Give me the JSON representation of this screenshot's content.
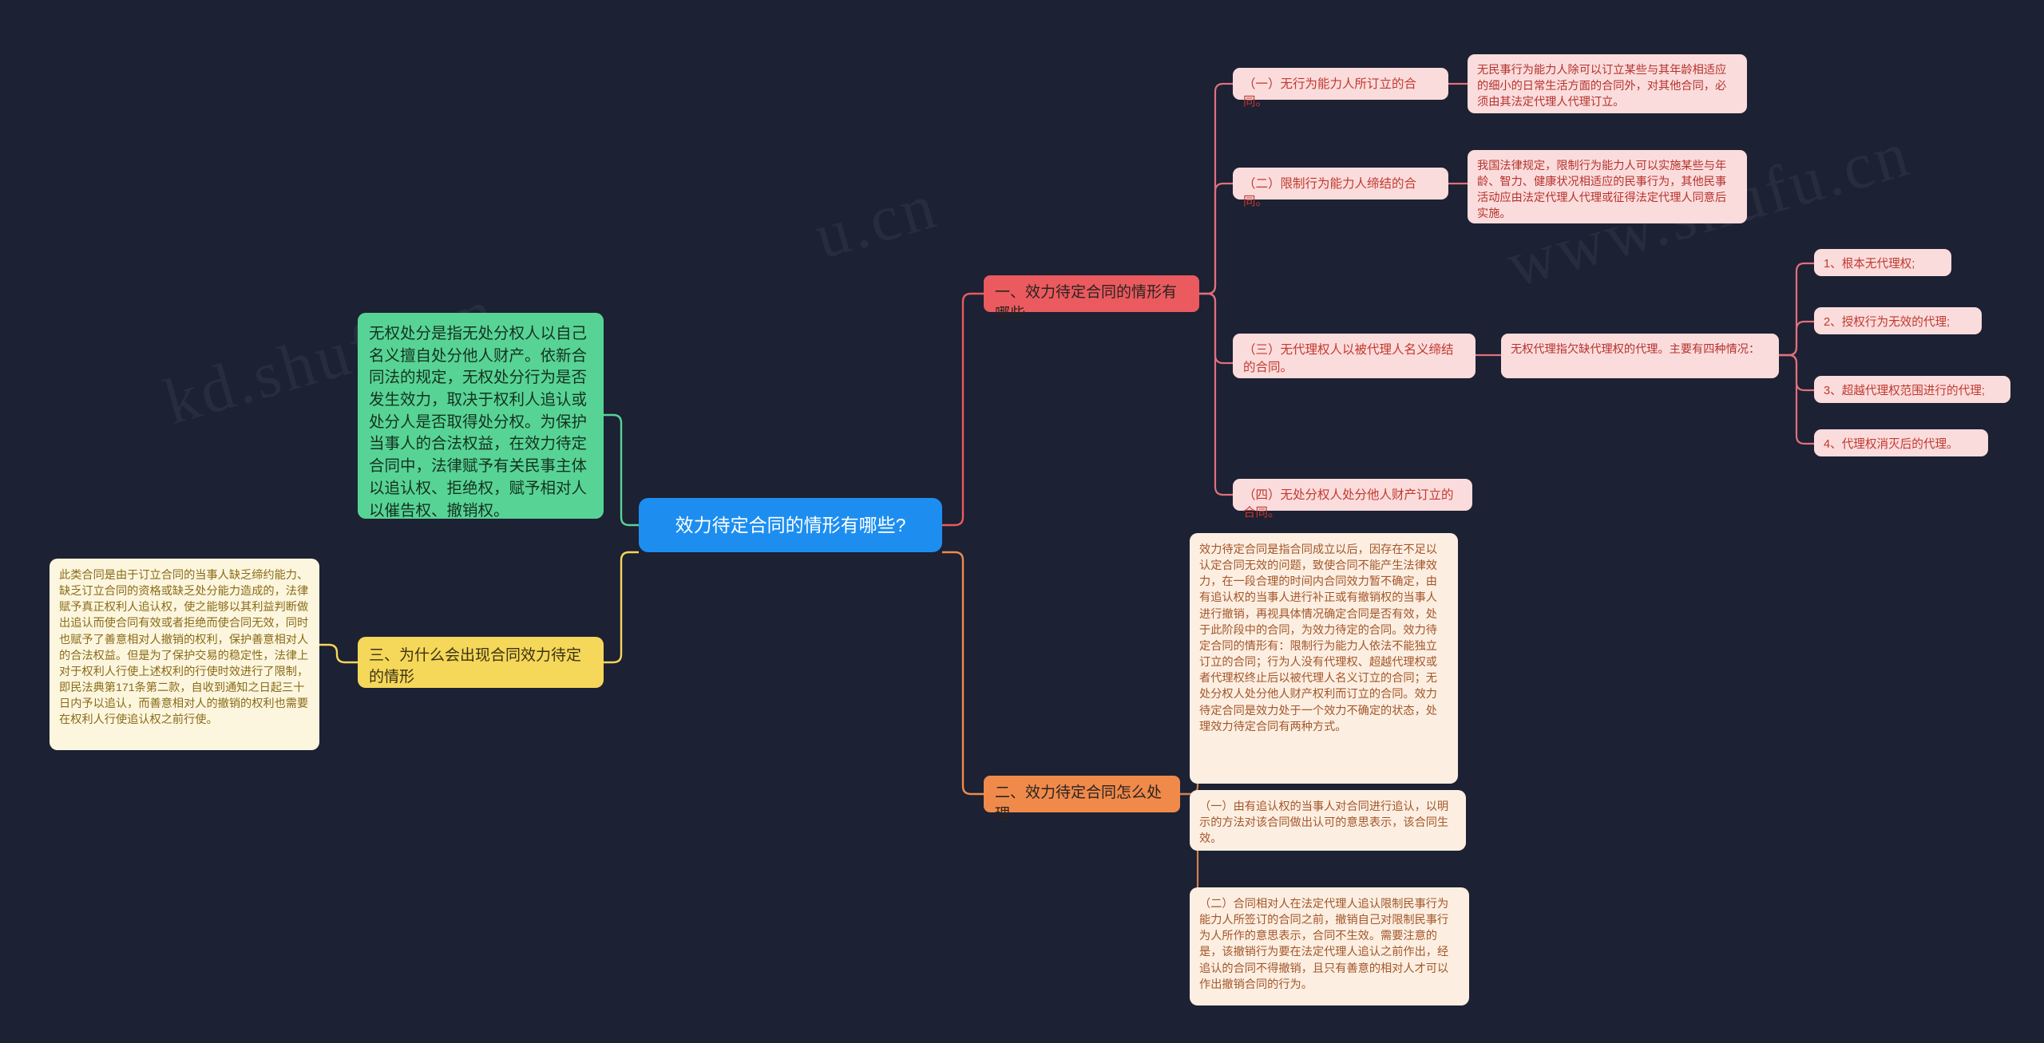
{
  "watermarks": [
    "kd.shufu.cn",
    "u.cn",
    "www.shufu.cn"
  ],
  "central": {
    "label": "效力待定合同的情形有哪些?",
    "color": "#1d8ef0"
  },
  "left_branch": {
    "green_note": "无权处分是指无处分权人以自己名义擅自处分他人财产。依新合同法的规定，无权处分行为是否发生效力，取决于权利人追认或处分人是否取得处分权。为保护当事人的合法权益，在效力待定合同中，法律赋予有关民事主体以追认权、拒绝权，赋予相对人以催告权、撤销权。",
    "green_color": "#58d396",
    "topic": "三、为什么会出现合同效力待定的情形",
    "topic_color": "#f5d759",
    "detail": "此类合同是由于订立合同的当事人缺乏缔约能力、缺乏订立合同的资格或缺乏处分能力造成的，法律赋予真正权利人追认权，使之能够以其利益判断做出追认而使合同有效或者拒绝而使合同无效，同时也赋予了善意相对人撤销的权利，保护善意相对人的合法权益。但是为了保护交易的稳定性，法律上对于权利人行使上述权利的行使时效进行了限制，即民法典第171条第二款，自收到通知之日起三十日内予以追认，而善意相对人的撤销的权利也需要在权利人行使追认权之前行使。",
    "detail_color": "#fdf6df"
  },
  "branch1": {
    "label": "一、效力待定合同的情形有哪些",
    "color": "#ea5a5e",
    "items": [
      {
        "label": "（一）无行为能力人所订立的合同。",
        "note": "无民事行为能力人除可以订立某些与其年龄相适应的细小的日常生活方面的合同外，对其他合同，必须由其法定代理人代理订立。"
      },
      {
        "label": "（二）限制行为能力人缔结的合同。",
        "note": "我国法律规定，限制行为能力人可以实施某些与年龄、智力、健康状况相适应的民事行为，其他民事活动应由法定代理人代理或征得法定代理人同意后实施。"
      },
      {
        "label": "（三）无代理权人以被代理人名义缔结的合同。",
        "note": "无权代理指欠缺代理权的代理。主要有四种情况：",
        "subitems": [
          "1、根本无代理权;",
          "2、授权行为无效的代理;",
          "3、超越代理权范围进行的代理;",
          "4、代理权消灭后的代理。"
        ]
      },
      {
        "label": "（四）无处分权人处分他人财产订立的合同。",
        "note": ""
      }
    ]
  },
  "branch2": {
    "label": "二、效力待定合同怎么处理",
    "color": "#f08a4b",
    "intro": "效力待定合同是指合同成立以后，因存在不足以认定合同无效的问题，致使合同不能产生法律效力，在一段合理的时间内合同效力暂不确定，由有追认权的当事人进行补正或有撤销权的当事人进行撤销，再视具体情况确定合同是否有效，处于此阶段中的合同，为效力待定的合同。效力待定合同的情形有：限制行为能力人依法不能独立订立的合同；行为人没有代理权、超越代理权或者代理权终止后以被代理人名义订立的合同；无处分权人处分他人财产权利而订立的合同。效力待定合同是效力处于一个效力不确定的状态，处理效力待定合同有两种方式。",
    "items": [
      "（一）由有追认权的当事人对合同进行追认，以明示的方法对该合同做出认可的意思表示，该合同生效。",
      "（二）合同相对人在法定代理人追认限制民事行为能力人所签订的合同之前，撤销自己对限制民事行为人所作的意思表示，合同不生效。需要注意的是，该撤销行为要在法定代理人追认之前作出，经追认的合同不得撤销，且只有善意的相对人才可以作出撤销合同的行为。"
    ]
  }
}
